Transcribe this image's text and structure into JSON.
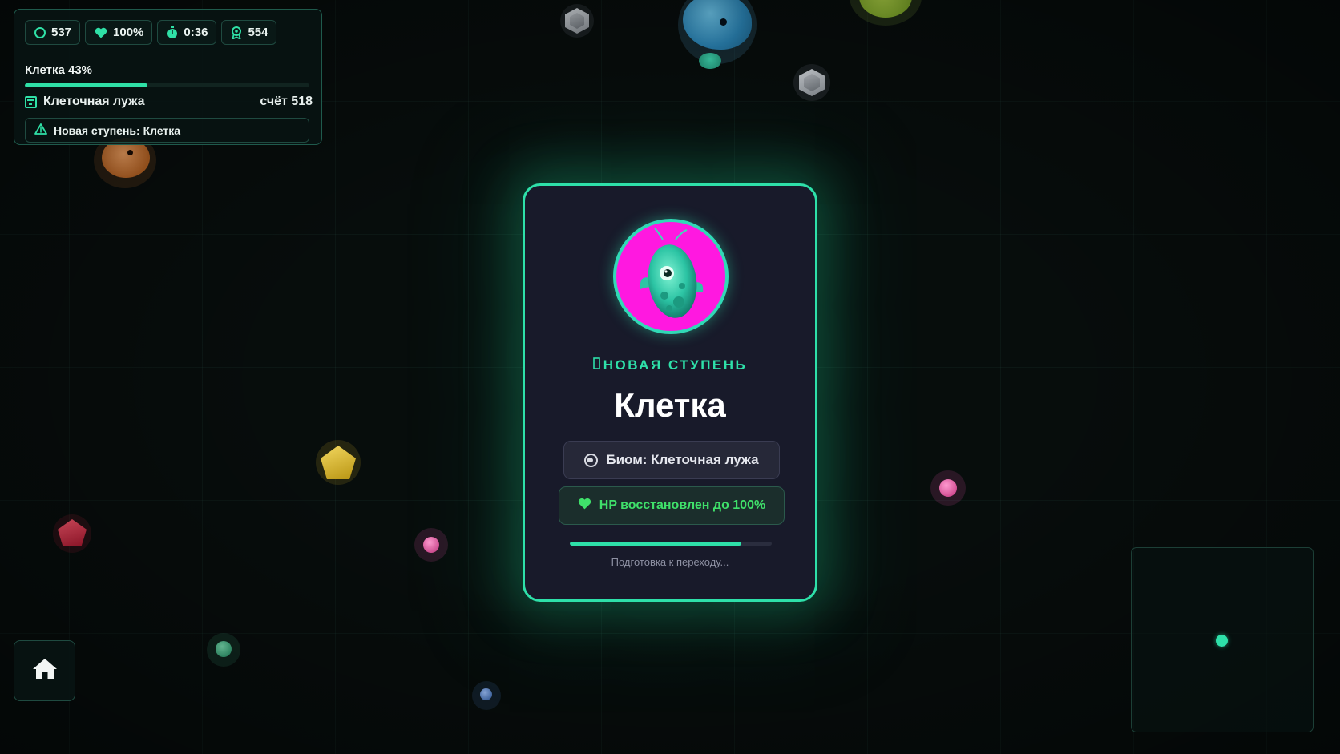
{
  "hud": {
    "stats": [
      {
        "icon": "circle-outline-icon",
        "value": "537"
      },
      {
        "icon": "heart-icon",
        "value": "100%"
      },
      {
        "icon": "stopwatch-icon",
        "value": "0:36"
      },
      {
        "icon": "award-icon",
        "value": "554"
      }
    ],
    "stage_label": "Клетка 43%",
    "stage_progress": 0.43,
    "biome_name": "Клеточная лужа",
    "score_text": "счёт 518",
    "notice": "Новая ступень: Клетка"
  },
  "modal": {
    "eyebrow": "НОВАЯ СТУПЕНЬ",
    "title": "Клетка",
    "biome_text": "Биом: Клеточная лужа",
    "hp_text": "HP восстановлен до 100%",
    "transition_progress": 0.85,
    "status_text": "Подготовка к переходу..."
  },
  "colors": {
    "accent": "#2ee0a9",
    "avatar_bg": "#ff18e0",
    "hp_text": "#3fe06a",
    "modal_bg": "#181a2a"
  },
  "home_button": {
    "icon": "home-icon"
  },
  "minimap": {
    "player_marker": "player-dot"
  }
}
